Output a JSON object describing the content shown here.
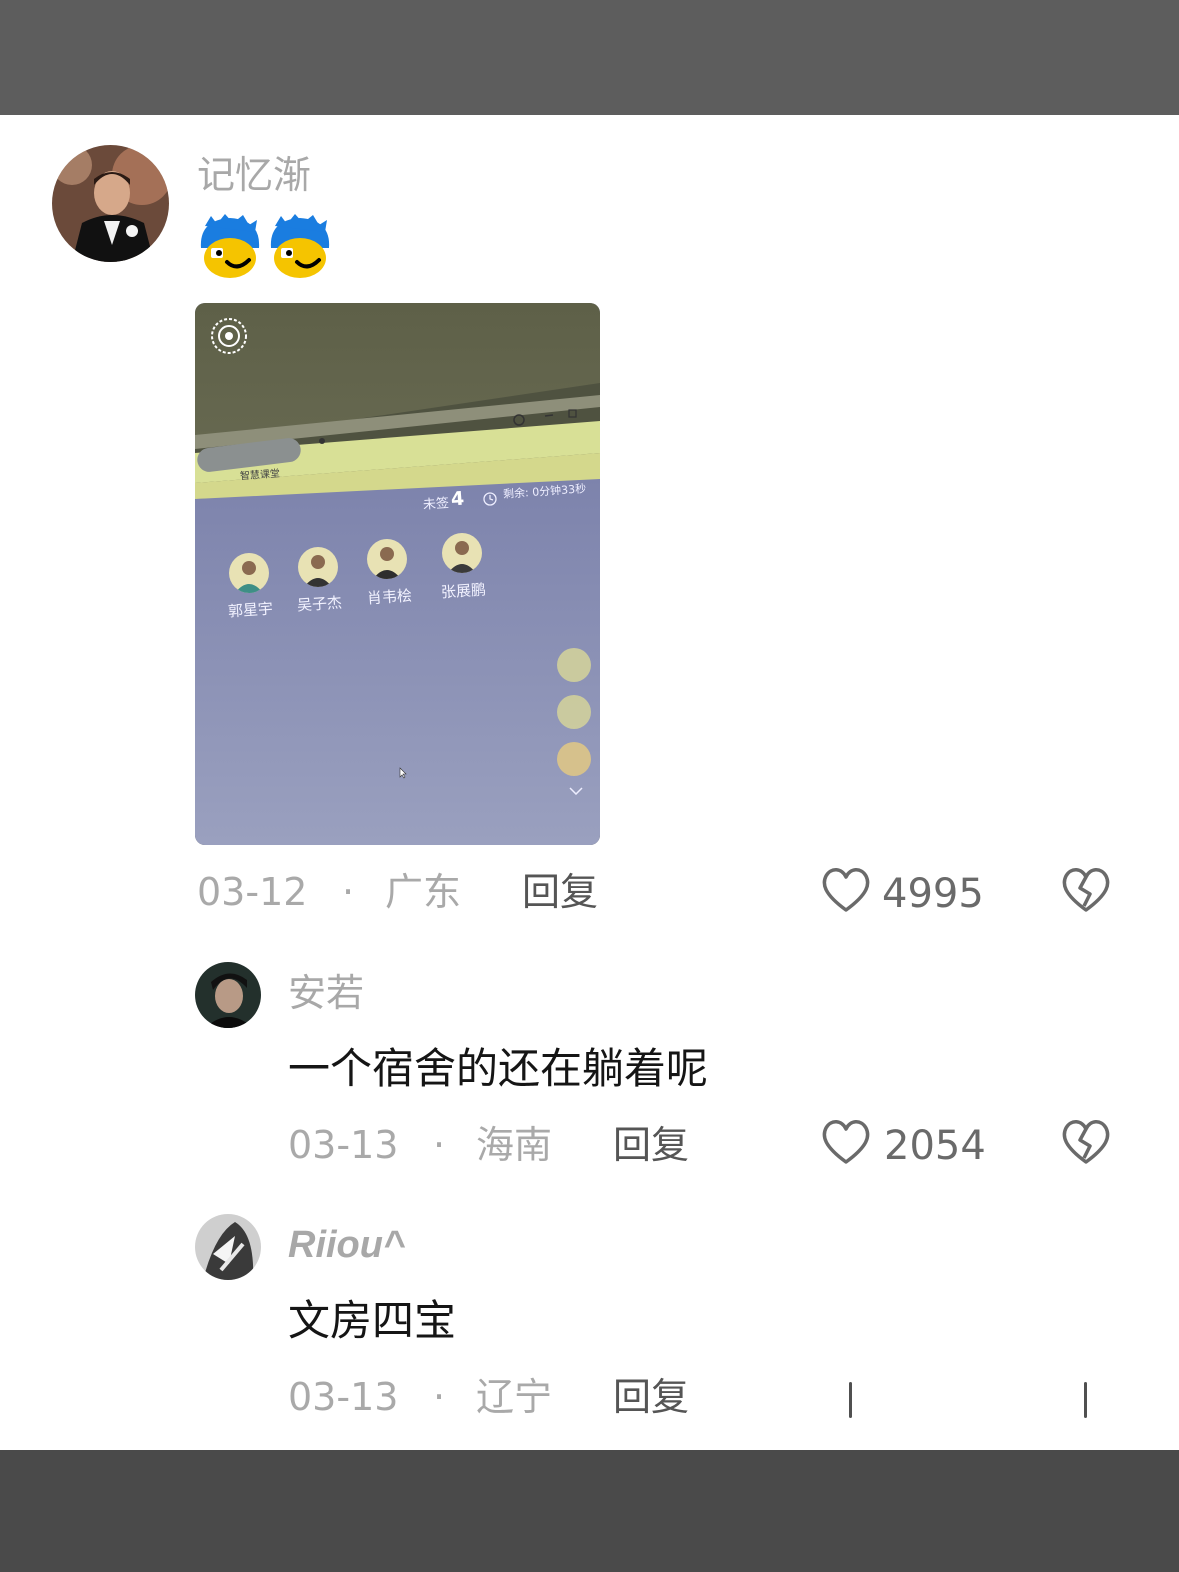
{
  "comments": [
    {
      "username": "记忆渐",
      "emoji": [
        "smiling-face-emoji",
        "smiling-face-emoji"
      ],
      "photo": {
        "top_tab": "智慧课堂",
        "unsigned_label": "未签",
        "unsigned_count": "4",
        "timer": "剩余: 0分钟33秒",
        "students": [
          "郭星宇",
          "吴子杰",
          "肖韦桧",
          "张展鹏"
        ]
      },
      "date": "03-12",
      "separator": "·",
      "location": "广东",
      "reply_label": "回复",
      "likes": "4995"
    },
    {
      "username": "安若",
      "text": "一个宿舍的还在躺着呢",
      "date": "03-13",
      "separator": "·",
      "location": "海南",
      "reply_label": "回复",
      "likes": "2054"
    },
    {
      "username": "Riiou^",
      "text": "文房四宝",
      "date": "03-13",
      "separator": "·",
      "location": "辽宁",
      "reply_label": "回复"
    }
  ],
  "colors": {
    "top_bar": "#5d5d5d",
    "bottom_bar": "#4a4a4a",
    "username": "#a8a8a8",
    "comment_text": "#151515",
    "meta": "#a9a9a9"
  }
}
